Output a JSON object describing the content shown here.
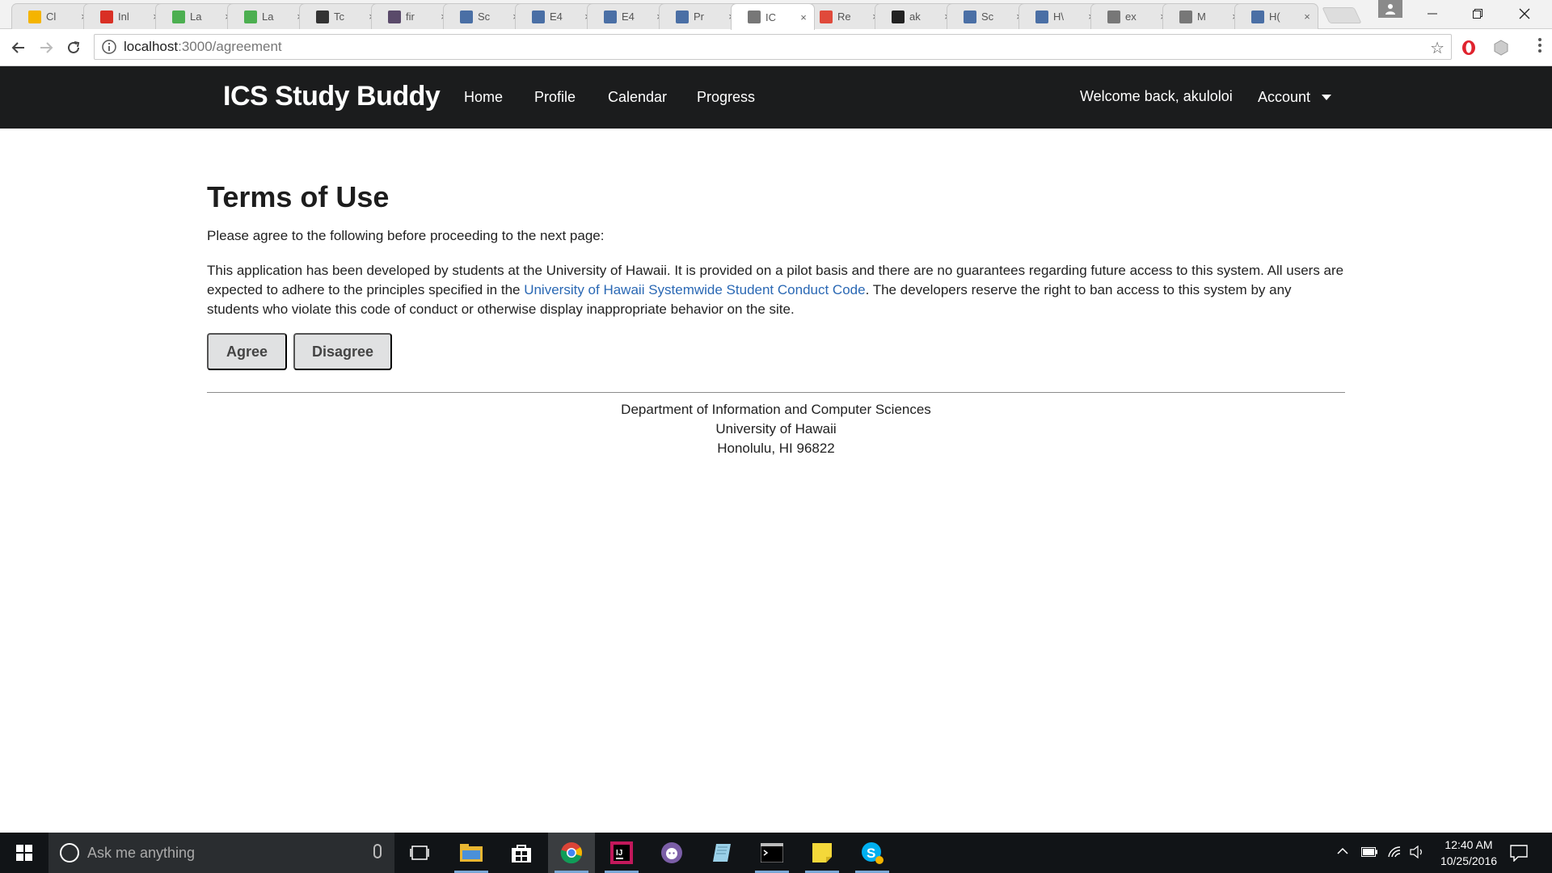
{
  "browser": {
    "tabs": [
      {
        "title": "Cl",
        "icon": "drive-icon",
        "color": "#f4b400"
      },
      {
        "title": "Inl",
        "icon": "gmail-icon",
        "color": "#d93025"
      },
      {
        "title": "La",
        "icon": "leaf-icon",
        "color": "#4caf50"
      },
      {
        "title": "La",
        "icon": "leaf-icon",
        "color": "#4caf50"
      },
      {
        "title": "Tc",
        "icon": "circle-icon",
        "color": "#333333"
      },
      {
        "title": "fir",
        "icon": "hash-icon",
        "color": "#5a4a6a"
      },
      {
        "title": "Sc",
        "icon": "doc-icon",
        "color": "#4a6fa5"
      },
      {
        "title": "E4",
        "icon": "doc-icon",
        "color": "#4a6fa5"
      },
      {
        "title": "E4",
        "icon": "doc-icon",
        "color": "#4a6fa5"
      },
      {
        "title": "Pr",
        "icon": "doc-icon",
        "color": "#4a6fa5"
      },
      {
        "title": "IC",
        "icon": "page-icon",
        "color": "#777777",
        "active": true
      },
      {
        "title": "Re",
        "icon": "c-icon",
        "color": "#e04a3b"
      },
      {
        "title": "ak",
        "icon": "github-icon",
        "color": "#222222"
      },
      {
        "title": "Sc",
        "icon": "doc-icon",
        "color": "#4a6fa5"
      },
      {
        "title": "H\\",
        "icon": "doc-icon",
        "color": "#4a6fa5"
      },
      {
        "title": "ex",
        "icon": "page-icon",
        "color": "#777777"
      },
      {
        "title": "M",
        "icon": "page-icon",
        "color": "#777777"
      },
      {
        "title": "H(",
        "icon": "doc-icon",
        "color": "#4a6fa5"
      }
    ],
    "tab_close_glyph": "×",
    "url": {
      "host": "localhost",
      "path": ":3000/agreement"
    }
  },
  "app": {
    "brand": "ICS Study Buddy",
    "nav": {
      "home": "Home",
      "profile": "Profile",
      "calendar": "Calendar",
      "progress": "Progress"
    },
    "welcome": "Welcome back, akuloloi",
    "account": "Account"
  },
  "page": {
    "title": "Terms of Use",
    "lead": "Please agree to the following before proceeding to the next page:",
    "terms_before_link": "This application has been developed by students at the University of Hawaii. It is provided on a pilot basis and there are no guarantees regarding future access to this system. All users are expected to adhere to the principles specified in the ",
    "terms_link": "University of Hawaii Systemwide Student Conduct Code",
    "terms_after_link": ". The developers reserve the right to ban access to this system by any students who violate this code of conduct or otherwise display inappropriate behavior on the site.",
    "agree": "Agree",
    "disagree": "Disagree",
    "link_color": "#2a68b4"
  },
  "footer": {
    "line1": "Department of Information and Computer Sciences",
    "line2": "University of Hawaii",
    "line3": "Honolulu, HI 96822"
  },
  "taskbar": {
    "search_placeholder": "Ask me anything",
    "time": "12:40 AM",
    "date": "10/25/2016",
    "apps": [
      "task-view-icon",
      "file-explorer-icon",
      "store-icon",
      "chrome-icon",
      "intellij-icon",
      "github-desktop-icon",
      "notepad-icon",
      "terminal-icon",
      "sticky-notes-icon",
      "skype-icon"
    ]
  }
}
